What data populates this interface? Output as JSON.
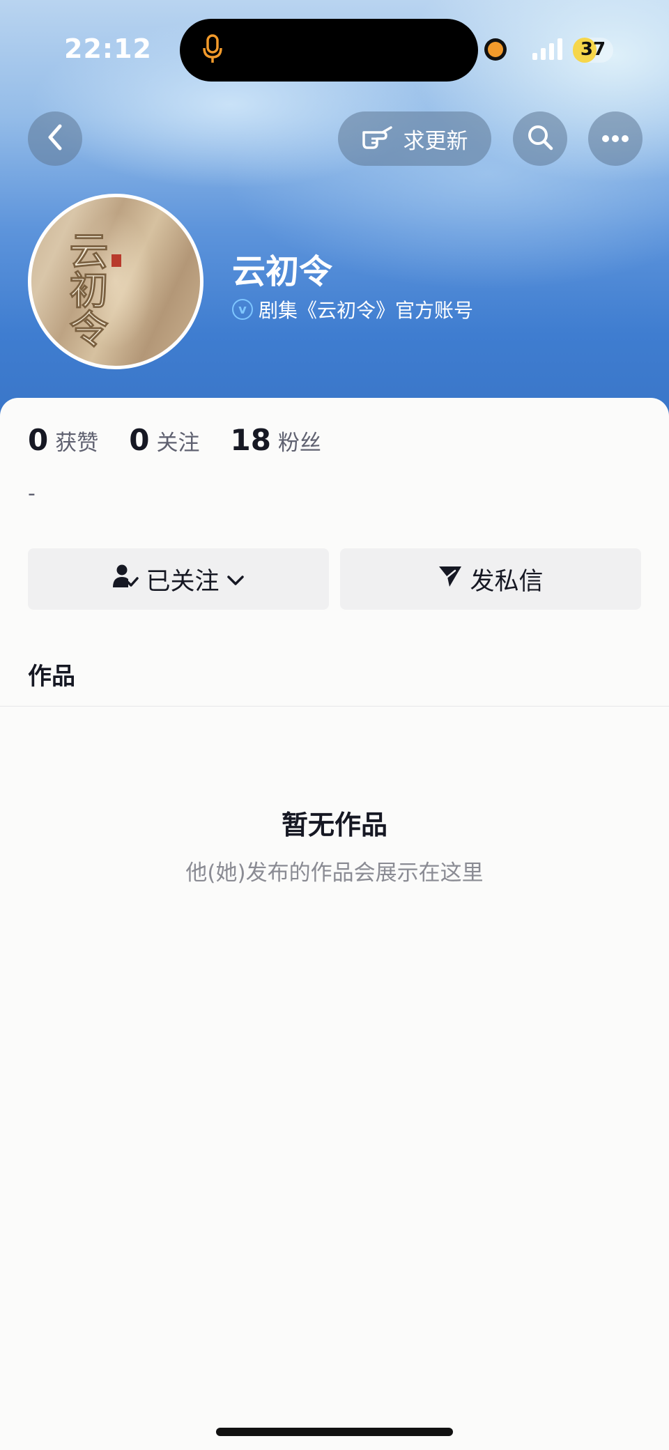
{
  "status_bar": {
    "time": "22:12",
    "battery": "37",
    "battery_level": 0.37,
    "accent_color": "#f6d64a"
  },
  "header": {
    "request_update_label": "求更新"
  },
  "profile": {
    "name": "云初令",
    "verification": "剧集《云初令》官方账号",
    "avatar_text": "云初令",
    "stats": [
      {
        "value": "0",
        "label": "获赞"
      },
      {
        "value": "0",
        "label": "关注"
      },
      {
        "value": "18",
        "label": "粉丝"
      }
    ],
    "bio": "-"
  },
  "actions": {
    "following_label": "已关注",
    "message_label": "发私信"
  },
  "tabs": {
    "works_label": "作品"
  },
  "empty_state": {
    "title": "暂无作品",
    "subtitle": "他(她)发布的作品会展示在这里"
  }
}
